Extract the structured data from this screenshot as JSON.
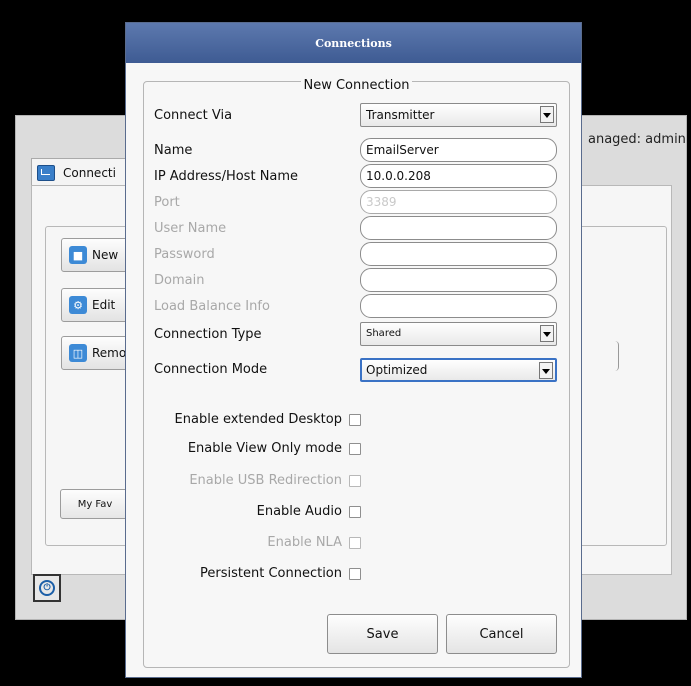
{
  "background": {
    "managed_text": "anaged: admin",
    "tab_label": "Connecti",
    "buttons": [
      {
        "label": "New",
        "icon": "connection-icon"
      },
      {
        "label": "Edit",
        "icon": "gear-icon"
      },
      {
        "label": "Remo",
        "icon": "trash-icon"
      }
    ],
    "favorites_label": "My Fav"
  },
  "dialog": {
    "title": "Connections",
    "group_title": "New Connection",
    "connect_via": {
      "label": "Connect Via",
      "value": "Transmitter"
    },
    "fields": [
      {
        "label": "Name",
        "value": "EmailServer",
        "enabled": true
      },
      {
        "label": "IP Address/Host Name",
        "value": "10.0.0.208",
        "enabled": true
      },
      {
        "label": "Port",
        "value": "3389",
        "enabled": false
      },
      {
        "label": "User Name",
        "value": "",
        "enabled": false
      },
      {
        "label": "Password",
        "value": "",
        "enabled": false
      },
      {
        "label": "Domain",
        "value": "",
        "enabled": false
      },
      {
        "label": "Load Balance Info",
        "value": "",
        "enabled": false
      }
    ],
    "connection_type": {
      "label": "Connection Type",
      "value": "Shared"
    },
    "connection_mode": {
      "label": "Connection Mode",
      "value": "Optimized"
    },
    "checkboxes": [
      {
        "label": "Enable extended Desktop",
        "checked": false,
        "enabled": true
      },
      {
        "label": "Enable View Only mode",
        "checked": false,
        "enabled": true
      },
      {
        "label": "Enable USB Redirection",
        "checked": false,
        "enabled": false
      },
      {
        "label": "Enable Audio",
        "checked": false,
        "enabled": true
      },
      {
        "label": "Enable NLA",
        "checked": false,
        "enabled": false
      },
      {
        "label": "Persistent Connection",
        "checked": false,
        "enabled": true
      }
    ],
    "save_label": "Save",
    "cancel_label": "Cancel"
  },
  "colors": {
    "titlebar": "#4a66a0",
    "focus_border": "#3a72c5",
    "disabled_text": "#a8a8a8"
  }
}
